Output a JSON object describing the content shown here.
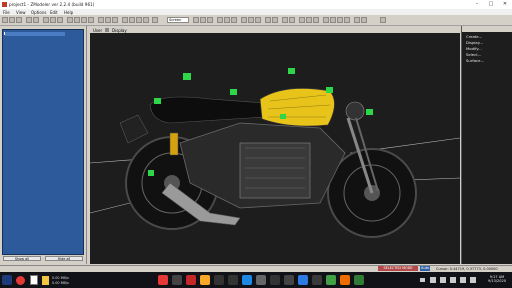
{
  "window": {
    "title": "project1 - ZModeler ver 2.2.4 (build 961)",
    "controls": [
      "–",
      "□",
      "✕"
    ]
  },
  "menubar": {
    "items": [
      "File",
      "View",
      "Options",
      "Edit",
      "Help"
    ]
  },
  "toolbar": {
    "select_value": "Screen"
  },
  "left_panel": {
    "scene_root": "",
    "show_all_label": "Show all",
    "hide_all_label": "Hide all"
  },
  "viewport": {
    "tab_user": "User",
    "tab_display": "Display"
  },
  "right_panel": {
    "items": [
      "Create...",
      "Display...",
      "Modify...",
      "Select...",
      "Surface..."
    ]
  },
  "status": {
    "selected_mode": "SELECTED MODE",
    "snap_mode": "Auto",
    "cursor_readout": "Cursor: 0.44719, 0.37773, 0.00000"
  },
  "taskbar": {
    "net_up": "0.00 MB/s",
    "net_down": "0.00 MB/s",
    "time": "9:27 AM",
    "date": "9/13/2020"
  },
  "colors": {
    "viewport_bg": "#1d1d1d",
    "selected_mode_bg": "#b34a4a",
    "scene_bg": "#2d5a9a",
    "tank_yellow": "#e8c31a",
    "marker_green": "#2ed64a"
  }
}
